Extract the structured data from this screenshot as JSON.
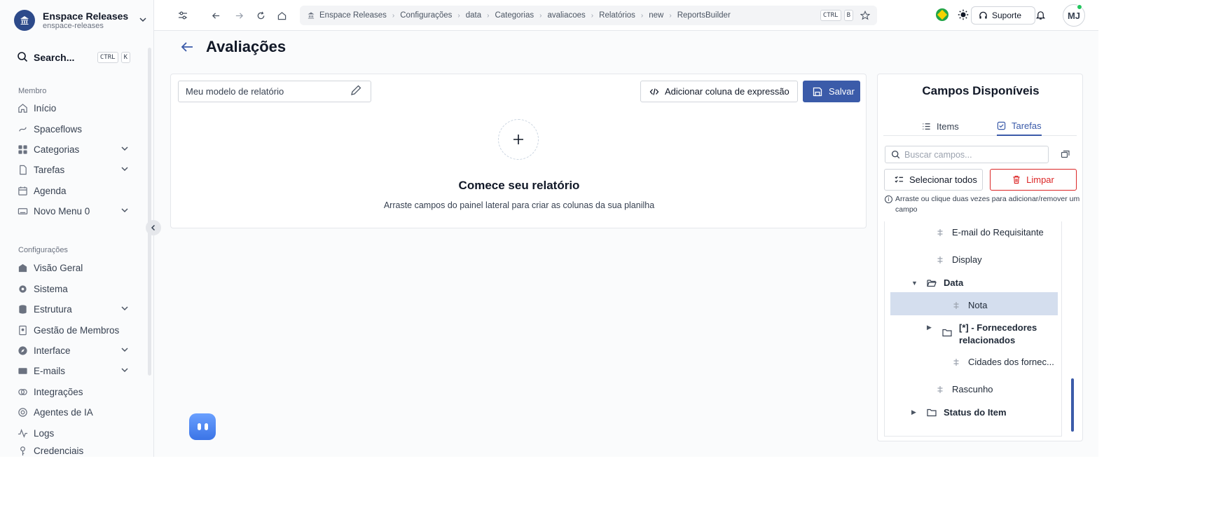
{
  "workspace": {
    "name": "Enspace Releases",
    "slug": "enspace-releases"
  },
  "search": {
    "label": "Search...",
    "kbd1": "CTRL",
    "kbd2": "K"
  },
  "sidebar": {
    "section1": "Membro",
    "items1": [
      {
        "label": "Início"
      },
      {
        "label": "Spaceflows"
      },
      {
        "label": "Categorias"
      },
      {
        "label": "Tarefas"
      },
      {
        "label": "Agenda"
      },
      {
        "label": "Novo Menu 0"
      }
    ],
    "section2": "Configurações",
    "items2": [
      {
        "label": "Visão Geral"
      },
      {
        "label": "Sistema"
      },
      {
        "label": "Estrutura"
      },
      {
        "label": "Gestão de Membros"
      },
      {
        "label": "Interface"
      },
      {
        "label": "E-mails"
      },
      {
        "label": "Integrações"
      },
      {
        "label": "Agentes de IA"
      },
      {
        "label": "Logs"
      },
      {
        "label": "Credenciais"
      }
    ]
  },
  "breadcrumb": [
    "Enspace Releases",
    "Configurações",
    "data",
    "Categorias",
    "avaliacoes",
    "Relatórios",
    "new",
    "ReportsBuilder"
  ],
  "breadcrumb_kbd": {
    "k1": "CTRL",
    "k2": "B"
  },
  "topbar": {
    "support": "Suporte",
    "avatar": "MJ"
  },
  "page": {
    "title": "Avaliações"
  },
  "report": {
    "template_value": "Meu modelo de relatório",
    "expr_button": "Adicionar coluna de expressão",
    "save_button": "Salvar",
    "empty_title": "Comece seu relatório",
    "empty_sub": "Arraste campos do painel lateral para criar as colunas da sua planilha"
  },
  "fields": {
    "title": "Campos Disponíveis",
    "tab_items": "Items",
    "tab_tasks": "Tarefas",
    "search_placeholder": "Buscar campos...",
    "select_all": "Selecionar todos",
    "clear": "Limpar",
    "hint": "Arraste ou clique duas vezes para adicionar/remover um campo",
    "tree": {
      "email": "E-mail do Requisitante",
      "display": "Display",
      "data": "Data",
      "nota": "Nota",
      "fornecedores": "[*] - Fornecedores relacionados",
      "cidades": "Cidades dos fornec...",
      "rascunho": "Rascunho",
      "status": "Status do Item"
    }
  },
  "colors": {
    "accent": "#3b5ba9",
    "danger": "#dc2626",
    "highlight": "#d4deee"
  }
}
